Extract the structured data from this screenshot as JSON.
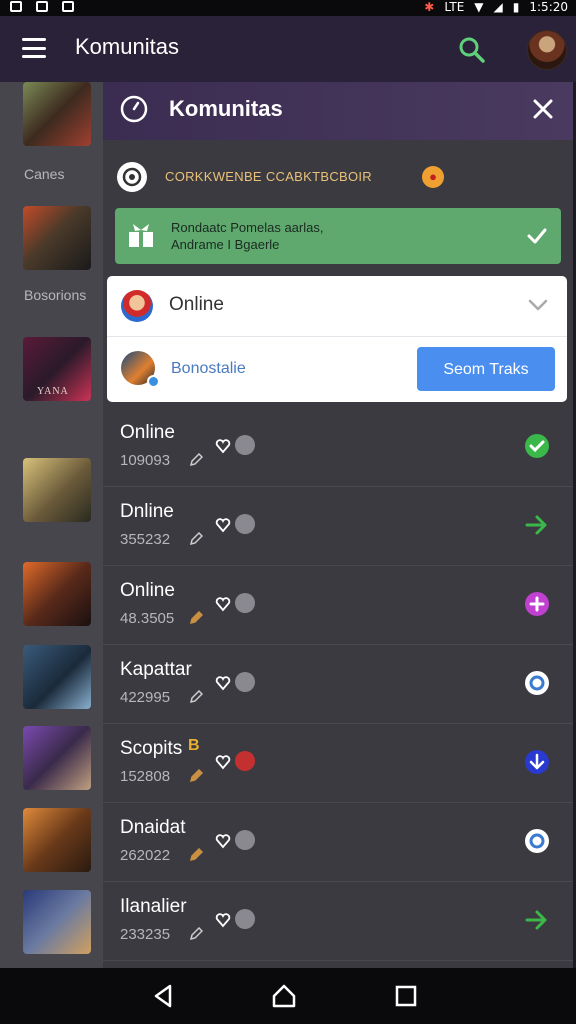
{
  "status_bar": {
    "time": "1:5:20",
    "network": "LTE"
  },
  "app_bar": {
    "title": "Komunitas"
  },
  "sidebar": {
    "labels": [
      "Canes",
      "Bosorions"
    ],
    "thumb_caption": "YANA"
  },
  "panel": {
    "title": "Komunitas",
    "promo_text": "CORKKWENBE CCABKTBCBOIR",
    "green_bar": {
      "line1": "Rondaatc Pomelas aarlas,",
      "line2": "Andrame I Bgaerle"
    },
    "online_row": {
      "label": "Online"
    },
    "user_row": {
      "name": "Bonostalie",
      "button": "Seom Traks"
    }
  },
  "list": [
    {
      "name": "Online",
      "number": "109093",
      "action": "check"
    },
    {
      "name": "Dnline",
      "number": "355232",
      "action": "arrow-right"
    },
    {
      "name": "Online",
      "number": "48.3505",
      "action": "plus"
    },
    {
      "name": "Kapattar",
      "number": "422995",
      "action": "circle"
    },
    {
      "name": "Scopits",
      "number": "152808",
      "action": "arrow-down",
      "badge": "B"
    },
    {
      "name": "Dnaidat",
      "number": "262022",
      "action": "circle"
    },
    {
      "name": "Ilanalier",
      "number": "233235",
      "action": "arrow-right"
    }
  ],
  "colors": {
    "accent_green": "#5fa96e",
    "button_blue": "#4a8ff0",
    "header_purple": "#3b2c52",
    "panel_bg": "#3b3a40"
  }
}
